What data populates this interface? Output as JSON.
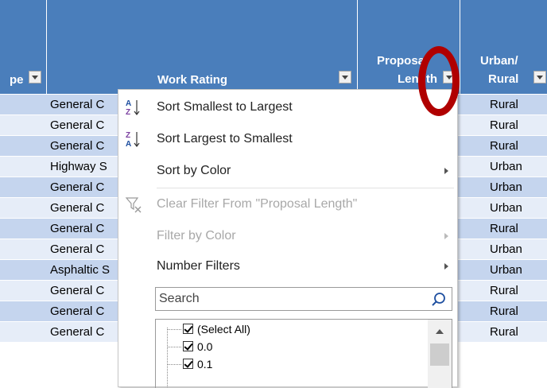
{
  "header": {
    "col_a_label": "pe",
    "work_rating_label": "Work Rating",
    "proposal_length_line1": "Proposal",
    "proposal_length_line2": "Length",
    "urban_rural_line1": "Urban/",
    "urban_rural_line2": "Rural"
  },
  "rows": [
    {
      "work": "General C",
      "ur": "Rural"
    },
    {
      "work": "General C",
      "ur": "Rural"
    },
    {
      "work": "General C",
      "ur": "Rural"
    },
    {
      "work": "Highway S",
      "ur": "Urban"
    },
    {
      "work": "General C",
      "ur": "Urban"
    },
    {
      "work": "General C",
      "ur": "Urban"
    },
    {
      "work": "General C",
      "ur": "Rural"
    },
    {
      "work": "General C",
      "ur": "Urban"
    },
    {
      "work": "Asphaltic S",
      "ur": "Urban"
    },
    {
      "work": "General C",
      "ur": "Rural"
    },
    {
      "work": "General C",
      "ur": "Rural"
    },
    {
      "work": "General C",
      "ur": "Rural"
    }
  ],
  "menu": {
    "sort_asc": "Sort Smallest to Largest",
    "sort_desc": "Sort Largest to Smallest",
    "sort_color": "Sort by Color",
    "clear_filter": "Clear Filter From \"Proposal Length\"",
    "filter_color": "Filter by Color",
    "number_filters": "Number Filters",
    "search_placeholder": "Search",
    "list_items": [
      "(Select All)",
      "0.0",
      "0.1"
    ]
  },
  "colors": {
    "header_bg": "#4a7ebb",
    "row_dark": "#c5d5ee",
    "row_light": "#e6edf8",
    "highlight_circle": "#b00000"
  },
  "icons": {
    "sort_asc": "sort-az-icon",
    "sort_desc": "sort-za-icon",
    "clear_filter": "clear-filter-icon",
    "search": "search-icon",
    "dropdown": "dropdown-arrow-icon"
  }
}
